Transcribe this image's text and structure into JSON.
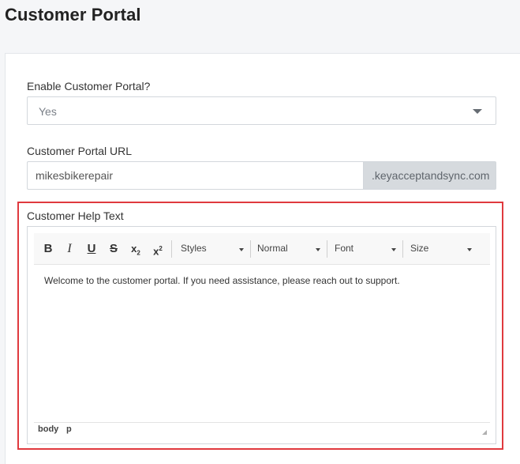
{
  "page": {
    "title": "Customer Portal"
  },
  "enable_portal": {
    "label": "Enable Customer Portal?",
    "selected": "Yes"
  },
  "portal_url": {
    "label": "Customer Portal URL",
    "value": "mikesbikerepair",
    "suffix": ".keyacceptandsync.com"
  },
  "help_text": {
    "label": "Customer Help Text",
    "toolbar": {
      "bold": "B",
      "italic": "I",
      "underline": "U",
      "strike": "S",
      "subscript": "x",
      "subscript_mark": "2",
      "superscript": "x",
      "superscript_mark": "2",
      "styles": "Styles",
      "format": "Normal",
      "font": "Font",
      "size": "Size"
    },
    "content": "Welcome to the customer portal. If you need assistance, please reach out to support.",
    "status_path": [
      "body",
      "p"
    ]
  },
  "colors": {
    "highlight": "#e0393e",
    "addon_bg": "#d6dade"
  }
}
